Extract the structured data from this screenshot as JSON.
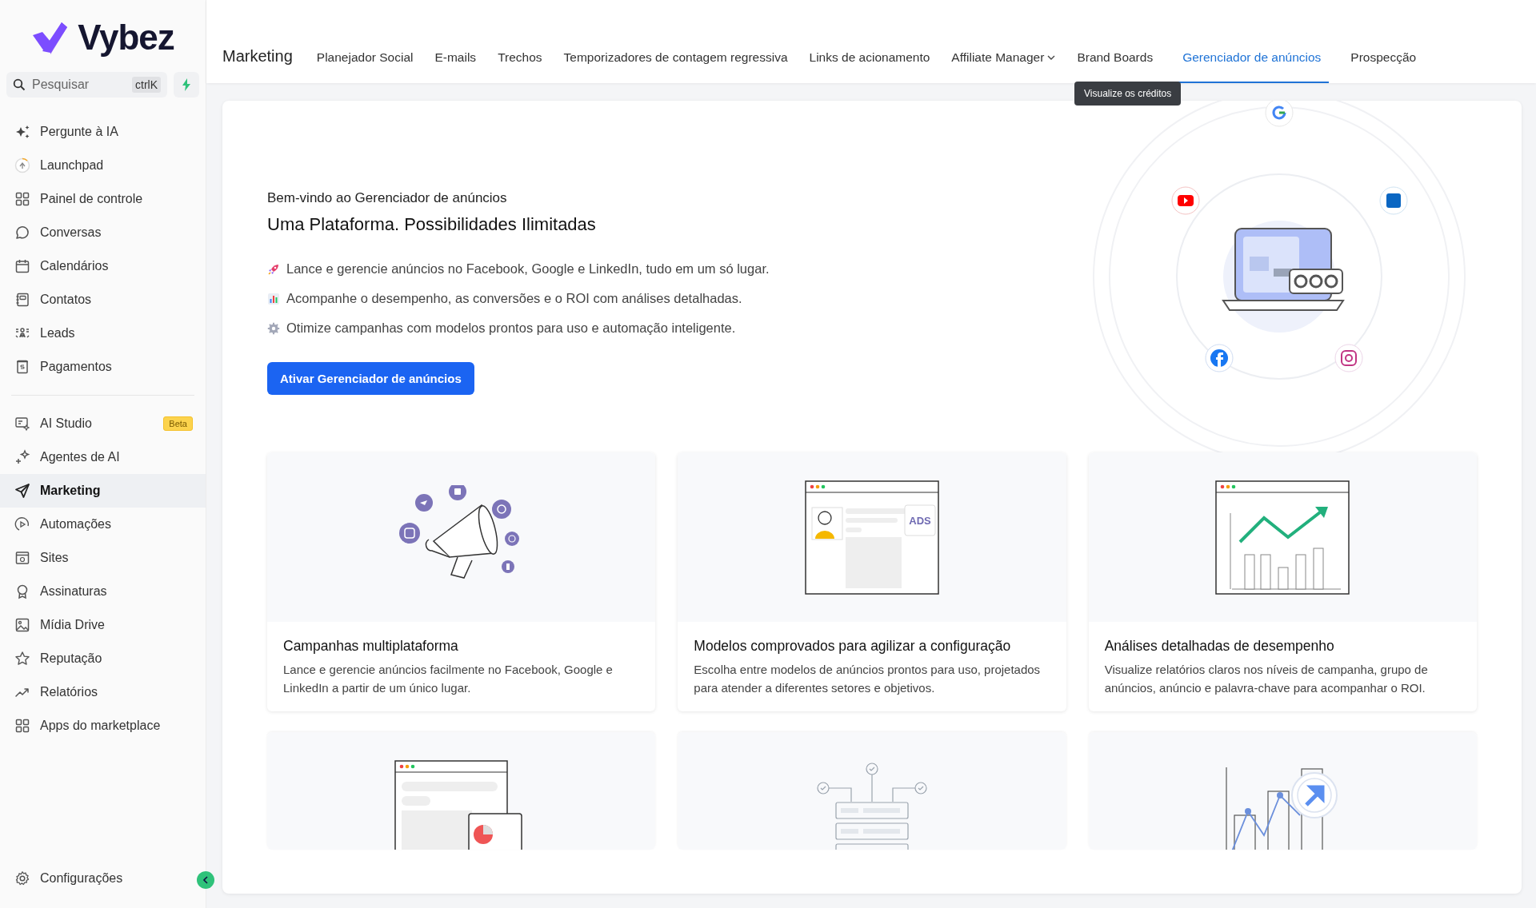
{
  "brand": {
    "name": "Vybez"
  },
  "search": {
    "placeholder": "Pesquisar",
    "shortcut": "ctrlK"
  },
  "sidebar": {
    "groups": [
      {
        "items": [
          {
            "label": "Pergunte à IA",
            "selected": false
          },
          {
            "label": "Launchpad",
            "selected": false
          },
          {
            "label": "Painel de controle",
            "selected": false
          },
          {
            "label": "Conversas",
            "selected": false
          },
          {
            "label": "Calendários",
            "selected": false
          },
          {
            "label": "Contatos",
            "selected": false
          },
          {
            "label": "Leads",
            "selected": false
          },
          {
            "label": "Pagamentos",
            "selected": false
          }
        ]
      },
      {
        "items": [
          {
            "label": "AI Studio",
            "selected": false,
            "badge": "Beta"
          },
          {
            "label": "Agentes de AI",
            "selected": false
          },
          {
            "label": "Marketing",
            "selected": true
          },
          {
            "label": "Automações",
            "selected": false
          },
          {
            "label": "Sites",
            "selected": false
          },
          {
            "label": "Assinaturas",
            "selected": false
          },
          {
            "label": "Mídia Drive",
            "selected": false
          },
          {
            "label": "Reputação",
            "selected": false
          },
          {
            "label": "Relatórios",
            "selected": false
          },
          {
            "label": "Apps do marketplace",
            "selected": false
          }
        ]
      }
    ],
    "footer": {
      "label": "Configurações"
    }
  },
  "nav": {
    "title": "Marketing",
    "tabs": [
      {
        "label": "Planejador Social",
        "selected": false,
        "dropdown": false
      },
      {
        "label": "E-mails",
        "selected": false,
        "dropdown": false
      },
      {
        "label": "Trechos",
        "selected": false,
        "dropdown": false
      },
      {
        "label": "Temporizadores de contagem regressiva",
        "selected": false,
        "dropdown": false
      },
      {
        "label": "Links de acionamento",
        "selected": false,
        "dropdown": false
      },
      {
        "label": "Affiliate Manager",
        "selected": false,
        "dropdown": true
      },
      {
        "label": "Brand Boards",
        "selected": false,
        "dropdown": false
      },
      {
        "label": "Gerenciador de anúncios",
        "selected": true,
        "dropdown": false
      },
      {
        "label": "Prospecção",
        "selected": false,
        "dropdown": false
      }
    ],
    "tooltip": "Visualize os créditos"
  },
  "hero": {
    "subtitle": "Bem-vindo ao Gerenciador de anúncios",
    "title": "Uma Plataforma. Possibilidades Ilimitadas",
    "bullets": [
      {
        "text": "Lance e gerencie anúncios no Facebook, Google e LinkedIn, tudo em um só lugar."
      },
      {
        "text": "Acompanhe o desempenho, as conversões e o ROI com análises detalhadas."
      },
      {
        "text": "Otimize campanhas com modelos prontos para uso e automação inteligente."
      }
    ],
    "button": "Ativar Gerenciador de anúncios"
  },
  "cards": [
    {
      "title": "Campanhas multiplataforma",
      "text": "Lance e gerencie anúncios facilmente no Facebook, Google e LinkedIn a partir de um único lugar."
    },
    {
      "ads_label": "ADS",
      "title": "Modelos comprovados para agilizar a configuração",
      "text": "Escolha entre modelos de anúncios prontos para uso, projetados para atender a diferentes setores e objetivos."
    },
    {
      "title": "Análises detalhadas de desempenho",
      "text": "Visualize relatórios claros nos níveis de campanha, grupo de anúncios, anúncio e palavra-chave para acompanhar o ROI."
    }
  ]
}
